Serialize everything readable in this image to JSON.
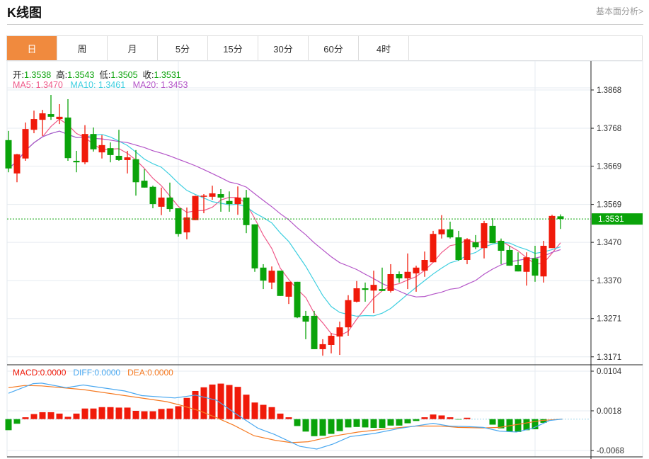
{
  "header": {
    "title": "K线图",
    "fundamental_link": "基本面分析>"
  },
  "tabs": [
    {
      "label": "日",
      "active": true
    },
    {
      "label": "周"
    },
    {
      "label": "月"
    },
    {
      "label": "5分"
    },
    {
      "label": "15分"
    },
    {
      "label": "30分"
    },
    {
      "label": "60分"
    },
    {
      "label": "4时"
    }
  ],
  "ohlc_legend": {
    "open_label": "开:",
    "open": "1.3538",
    "high_label": "高:",
    "high": "1.3543",
    "low_label": "低:",
    "low": "1.3505",
    "close_label": "收:",
    "close": "1.3531"
  },
  "ma_legend": {
    "ma5": "MA5: 1.3470",
    "ma10": "MA10: 1.3461",
    "ma20": "MA20: 1.3453"
  },
  "macd_legend": {
    "macd": "MACD:0.0000",
    "diff": "DIFF:0.0000",
    "dea": "DEA:0.0000"
  },
  "colors": {
    "up": "#f01a0a",
    "down": "#0aa30a",
    "ma5": "#ef5a8a",
    "ma10": "#3fcfe0",
    "ma20": "#b455c8",
    "diff": "#4aa8f0",
    "dea": "#f57a22",
    "accent": "#f08a3e"
  },
  "chart_data": [
    {
      "type": "candlestick",
      "current_price": "1.3531",
      "y_ticks": [
        "1.3868",
        "1.3768",
        "1.3669",
        "1.3569",
        "1.3470",
        "1.3370",
        "1.3271",
        "1.3171"
      ],
      "ohlc": [
        [
          1.3737,
          1.3761,
          1.3653,
          1.3663
        ],
        [
          1.365,
          1.3701,
          1.3627,
          1.37
        ],
        [
          1.3689,
          1.3783,
          1.3683,
          1.3766
        ],
        [
          1.3764,
          1.3814,
          1.3755,
          1.3792
        ],
        [
          1.379,
          1.3816,
          1.3748,
          1.3807
        ],
        [
          1.3805,
          1.3855,
          1.379,
          1.3798
        ],
        [
          1.3792,
          1.3831,
          1.3779,
          1.3798
        ],
        [
          1.3796,
          1.3844,
          1.3683,
          1.369
        ],
        [
          1.3683,
          1.3709,
          1.3653,
          1.3679
        ],
        [
          1.3679,
          1.3776,
          1.3674,
          1.3753
        ],
        [
          1.3753,
          1.377,
          1.3707,
          1.3713
        ],
        [
          1.3705,
          1.375,
          1.3689,
          1.3724
        ],
        [
          1.3716,
          1.3731,
          1.3679,
          1.3698
        ],
        [
          1.3696,
          1.3764,
          1.3683,
          1.3685
        ],
        [
          1.3685,
          1.3709,
          1.365,
          1.3692
        ],
        [
          1.3687,
          1.3711,
          1.3592,
          1.3627
        ],
        [
          1.3631,
          1.3661,
          1.3613,
          1.3613
        ],
        [
          1.3615,
          1.3618,
          1.3559,
          1.357
        ],
        [
          1.3563,
          1.3613,
          1.3541,
          1.3587
        ],
        [
          1.3587,
          1.3626,
          1.355,
          1.3557
        ],
        [
          1.3559,
          1.3559,
          1.3485,
          1.3492
        ],
        [
          1.3496,
          1.3561,
          1.3478,
          1.3535
        ],
        [
          1.3528,
          1.3592,
          1.3528,
          1.3591
        ],
        [
          1.3589,
          1.3596,
          1.3546,
          1.3592
        ],
        [
          1.3589,
          1.3618,
          1.3581,
          1.3598
        ],
        [
          1.3596,
          1.3609,
          1.355,
          1.3587
        ],
        [
          1.3578,
          1.3603,
          1.355,
          1.357
        ],
        [
          1.357,
          1.3616,
          1.3542,
          1.3587
        ],
        [
          1.3587,
          1.3607,
          1.3494,
          1.3515
        ],
        [
          1.3517,
          1.3517,
          1.3393,
          1.3402
        ],
        [
          1.3404,
          1.3413,
          1.3348,
          1.337
        ],
        [
          1.3365,
          1.3407,
          1.3348,
          1.3396
        ],
        [
          1.3396,
          1.3396,
          1.333,
          1.333
        ],
        [
          1.3328,
          1.3367,
          1.3309,
          1.3367
        ],
        [
          1.3367,
          1.3367,
          1.3272,
          1.3274
        ],
        [
          1.3278,
          1.3291,
          1.3217,
          1.3263
        ],
        [
          1.3278,
          1.3291,
          1.3191,
          1.3191
        ],
        [
          1.3191,
          1.3217,
          1.3174,
          1.3204
        ],
        [
          1.3202,
          1.3233,
          1.318,
          1.3226
        ],
        [
          1.3224,
          1.3263,
          1.3176,
          1.3248
        ],
        [
          1.3248,
          1.3332,
          1.3226,
          1.3319
        ],
        [
          1.3315,
          1.3369,
          1.3313,
          1.335
        ],
        [
          1.335,
          1.3365,
          1.3315,
          1.3346
        ],
        [
          1.3344,
          1.3396,
          1.3285,
          1.3359
        ],
        [
          1.3348,
          1.3404,
          1.3343,
          1.3343
        ],
        [
          1.3343,
          1.3413,
          1.3339,
          1.3387
        ],
        [
          1.3387,
          1.3394,
          1.3365,
          1.3376
        ],
        [
          1.3376,
          1.3441,
          1.3348,
          1.3393
        ],
        [
          1.3389,
          1.3409,
          1.3341,
          1.3404
        ],
        [
          1.3396,
          1.3446,
          1.338,
          1.3424
        ],
        [
          1.3418,
          1.35,
          1.3418,
          1.3492
        ],
        [
          1.3491,
          1.3541,
          1.348,
          1.3504
        ],
        [
          1.3504,
          1.3524,
          1.348,
          1.3483
        ],
        [
          1.3483,
          1.35,
          1.3422,
          1.3424
        ],
        [
          1.3424,
          1.3481,
          1.3413,
          1.3478
        ],
        [
          1.347,
          1.3489,
          1.3452,
          1.3457
        ],
        [
          1.3455,
          1.3526,
          1.3428,
          1.352
        ],
        [
          1.3513,
          1.3533,
          1.3468,
          1.3468
        ],
        [
          1.3474,
          1.348,
          1.3413,
          1.3448
        ],
        [
          1.345,
          1.3461,
          1.3409,
          1.3409
        ],
        [
          1.3411,
          1.3444,
          1.3394,
          1.3394
        ],
        [
          1.3393,
          1.3444,
          1.3357,
          1.3431
        ],
        [
          1.3428,
          1.3461,
          1.3367,
          1.3383
        ],
        [
          1.3381,
          1.3474,
          1.3365,
          1.3461
        ],
        [
          1.3455,
          1.3542,
          1.3455,
          1.3539
        ],
        [
          1.3538,
          1.3543,
          1.3505,
          1.3531
        ]
      ],
      "ohlc_order": "open,high,low,close",
      "ma_periods": [
        5,
        10,
        20
      ]
    },
    {
      "type": "macd",
      "y_ticks": [
        "0.0104",
        "0.0018",
        "-0.0068"
      ],
      "histogram": [
        -0.0024,
        -0.001,
        0.0004,
        0.0011,
        0.0015,
        0.0015,
        0.0012,
        0.0005,
        0.0012,
        0.0023,
        0.0023,
        0.0026,
        0.0026,
        0.0025,
        0.0025,
        0.0018,
        0.0017,
        0.0017,
        0.0022,
        0.0023,
        0.0028,
        0.0046,
        0.0061,
        0.0069,
        0.0075,
        0.0077,
        0.0074,
        0.007,
        0.0053,
        0.0036,
        0.0031,
        0.0026,
        0.0012,
        0.0004,
        -0.0015,
        -0.0027,
        -0.0037,
        -0.0036,
        -0.0032,
        -0.0026,
        -0.0018,
        -0.0017,
        -0.0018,
        -0.0019,
        -0.0019,
        -0.0014,
        -0.0014,
        -0.0009,
        -0.0004,
        0.0004,
        0.001,
        0.0008,
        0.0004,
        -0.0001,
        0.0003,
        0,
        0,
        -0.0012,
        -0.002,
        -0.0027,
        -0.0028,
        -0.0024,
        -0.0022,
        -0.0008,
        0,
        0
      ],
      "diff": [
        [
          0,
          0.0056
        ],
        [
          2.9,
          0.0077
        ],
        [
          3.9,
          0.0078
        ],
        [
          6.8,
          0.0068
        ],
        [
          8.8,
          0.0074
        ],
        [
          13.7,
          0.0061
        ],
        [
          15.7,
          0.0051
        ],
        [
          19.6,
          0.0046
        ],
        [
          22,
          0.0052
        ],
        [
          24.5,
          0.0041
        ],
        [
          26.9,
          0.001
        ],
        [
          29.4,
          -0.002
        ],
        [
          31.3,
          -0.0033
        ],
        [
          34.3,
          -0.0059
        ],
        [
          36.3,
          -0.0065
        ],
        [
          38.2,
          -0.0054
        ],
        [
          40.2,
          -0.0038
        ],
        [
          43.1,
          -0.0031
        ],
        [
          46.1,
          -0.002
        ],
        [
          50,
          -0.0009
        ],
        [
          51.9,
          -0.0015
        ],
        [
          53.9,
          -0.0016
        ],
        [
          55.9,
          -0.0018
        ],
        [
          57.8,
          -0.0026
        ],
        [
          59.8,
          -0.0028
        ],
        [
          61.7,
          -0.002
        ],
        [
          63.7,
          -0.0003
        ],
        [
          65.2,
          0
        ]
      ],
      "dea": [
        [
          0,
          0.0068
        ],
        [
          1.9,
          0.0073
        ],
        [
          3.9,
          0.0072
        ],
        [
          8.8,
          0.0064
        ],
        [
          13.7,
          0.0051
        ],
        [
          18.6,
          0.0038
        ],
        [
          20.1,
          0.0031
        ],
        [
          22.5,
          0.0018
        ],
        [
          24.5,
          0.0003
        ],
        [
          26.5,
          -0.0013
        ],
        [
          28.9,
          -0.0036
        ],
        [
          31.4,
          -0.0046
        ],
        [
          33.3,
          -0.0051
        ],
        [
          35.3,
          -0.0049
        ],
        [
          38.2,
          -0.0037
        ],
        [
          41.2,
          -0.0028
        ],
        [
          45.1,
          -0.002
        ],
        [
          48,
          -0.0015
        ],
        [
          51,
          -0.0015
        ],
        [
          52.9,
          -0.0018
        ],
        [
          55.9,
          -0.0019
        ],
        [
          57.8,
          -0.0018
        ],
        [
          59.8,
          -0.0012
        ],
        [
          62.7,
          -0.0003
        ],
        [
          65.2,
          0
        ]
      ]
    }
  ]
}
